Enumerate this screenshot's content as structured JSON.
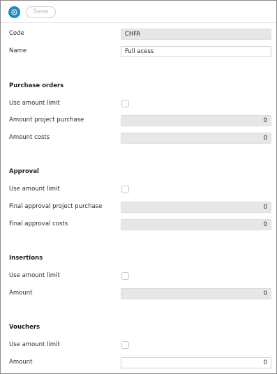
{
  "toolbar": {
    "save_label": "Save"
  },
  "general": {
    "code_label": "Code",
    "code_value": "CHFA",
    "name_label": "Name",
    "name_value": "Full acess"
  },
  "purchase_orders": {
    "title": "Purchase orders",
    "use_limit_label": "Use amount limit",
    "project_purchase_label": "Amount project purchase",
    "project_purchase_value": "0",
    "costs_label": "Amount costs",
    "costs_value": "0"
  },
  "approval": {
    "title": "Approval",
    "use_limit_label": "Use amount limit",
    "final_project_label": "Final approval project purchase",
    "final_project_value": "0",
    "final_costs_label": "Final approval costs",
    "final_costs_value": "0"
  },
  "insertions": {
    "title": "Insertions",
    "use_limit_label": "Use amount limit",
    "amount_label": "Amount",
    "amount_value": "0"
  },
  "vouchers": {
    "title": "Vouchers",
    "use_limit_label": "Use amount limit",
    "amount_label": "Amount",
    "amount_value": "0"
  }
}
